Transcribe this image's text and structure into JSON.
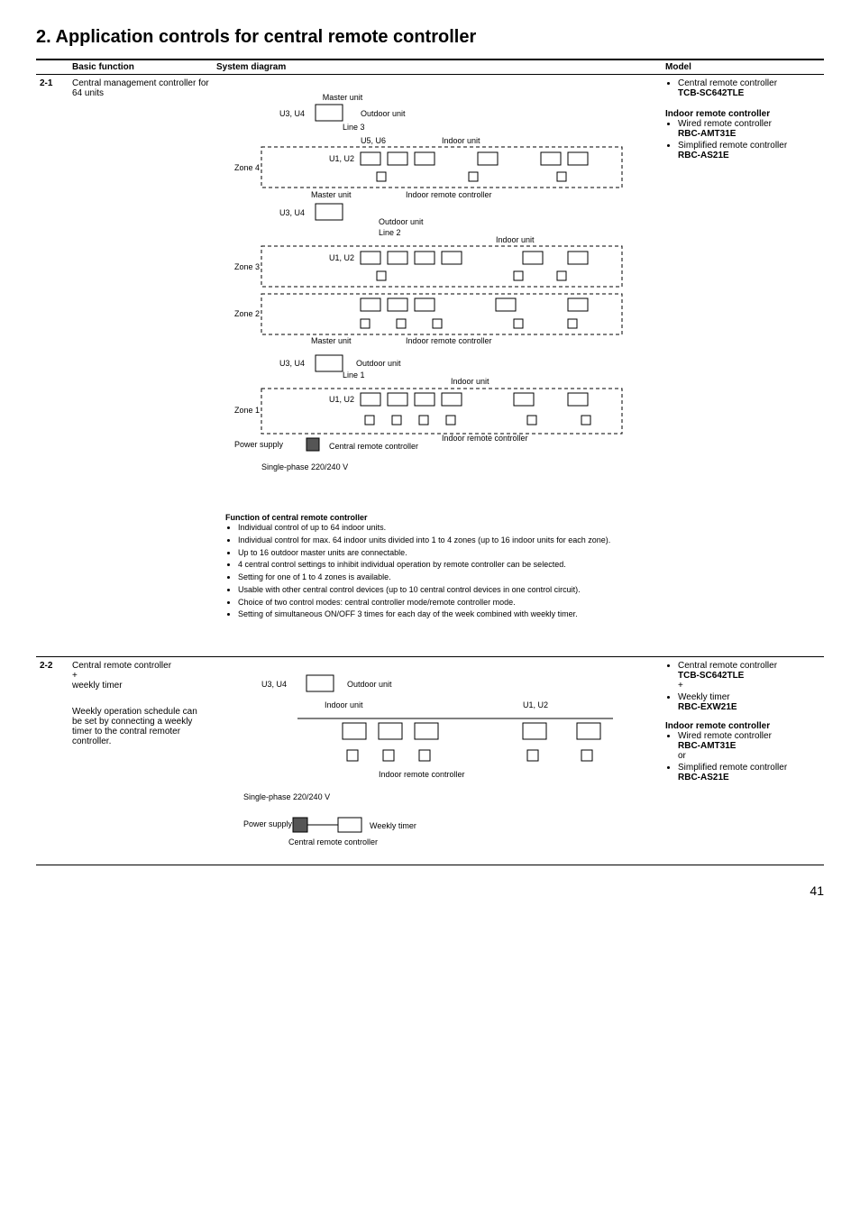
{
  "title": "2.  Application controls for central remote controller",
  "headers": {
    "num": "",
    "basic": "Basic function",
    "diagram": "System diagram",
    "model": "Model"
  },
  "rows": [
    {
      "num": "2-1",
      "basic_title": "Central management controller for 64 units",
      "basic_extra": "",
      "diagram_labels": {
        "master_unit": "Master\nunit",
        "u3u4": "U3, U4",
        "outdoor": "Outdoor unit",
        "line3": "Line 3",
        "u5u6": "U5, U6",
        "indoor": "Indoor unit",
        "u1u2": "U1, U2",
        "zone4": "Zone 4",
        "zone3": "Zone 3",
        "zone2": "Zone 2",
        "zone1": "Zone 1",
        "line2": "Line 2",
        "line1": "Line 1",
        "indoor_rc": "Indoor remote controller",
        "power": "Power\nsupply",
        "central_rc": "Central\nremote controller",
        "phase": "Single-phase\n220/240 V"
      },
      "function_heading": "Function of central remote controller",
      "function_items": [
        "Individual control of up to 64 indoor units.",
        "Individual control for max. 64 indoor units divided into 1 to 4 zones (up to 16 indoor units for each zone).",
        "Up to 16 outdoor master units are connectable.",
        "4 central control settings to inhibit individual operation by remote controller can be selected.",
        "Setting for one of 1 to 4 zones is available.",
        "Usable with other central control devices (up to 10 central control devices in one control circuit).",
        "Choice of two control modes: central controller mode/remote controller mode.",
        "Setting of simultaneous ON/OFF 3 times for each day of the week combined with weekly timer."
      ],
      "model_items": [
        {
          "text": "Central remote controller",
          "sub": "TCB-SC642TLE"
        }
      ],
      "model_group2_heading": "Indoor remote controller",
      "model_group2": [
        {
          "text": "Wired remote controller",
          "sub": "RBC-AMT31E"
        },
        {
          "text": "Simplified remote controller",
          "sub": "RBC-AS21E"
        }
      ]
    },
    {
      "num": "2-2",
      "basic_title": "Central remote controller\n+\nweekly timer",
      "basic_extra": "Weekly operation schedule can be set by connecting a weekly timer to the contral remoter controller.",
      "diagram_labels": {
        "u3u4": "U3, U4",
        "outdoor": "Outdoor unit",
        "indoor": "Indoor unit",
        "u1u2": "U1, U2",
        "indoor_rc": "Indoor remote controller",
        "phase": "Single-phase\n220/240 V",
        "power": "Power\nsupply",
        "central_rc": "Central\nremote controller",
        "weekly": "Weekly timer"
      },
      "model_items": [
        {
          "text": "Central remote controller",
          "sub": "TCB-SC642TLE",
          "plus": "+"
        },
        {
          "text": "Weekly timer",
          "sub": "RBC-EXW21E"
        }
      ],
      "model_group2_heading": "Indoor remote controller",
      "model_group2": [
        {
          "text": "Wired remote controller",
          "sub": "RBC-AMT31E",
          "or": "or"
        },
        {
          "text": "Simplified remote controller",
          "sub": "RBC-AS21E"
        }
      ]
    }
  ],
  "page_number": "41"
}
